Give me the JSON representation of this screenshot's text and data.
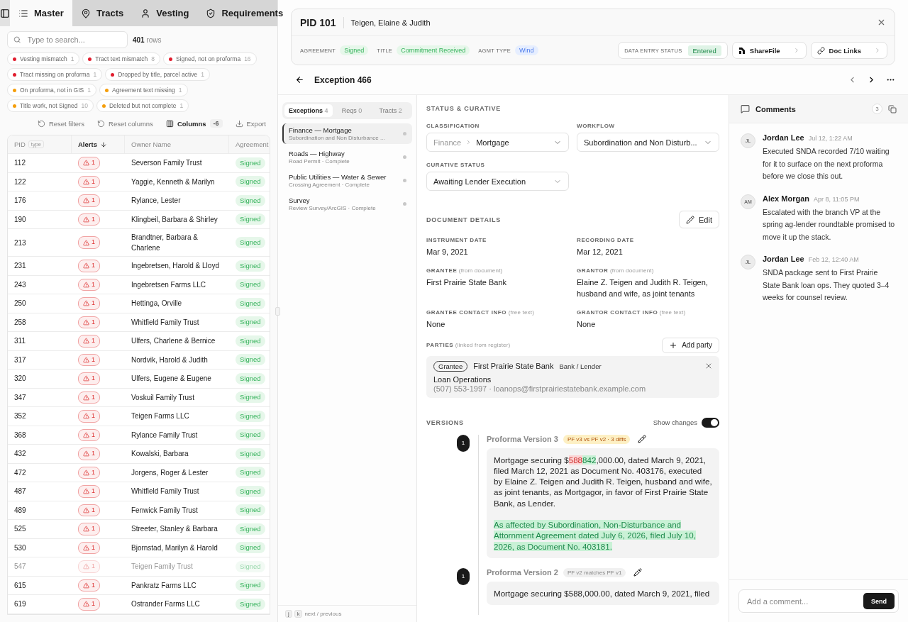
{
  "nav_tabs": [
    {
      "label": "Master",
      "kind": "list",
      "selected": true
    },
    {
      "label": "Tracts",
      "kind": "pin",
      "selected": false
    },
    {
      "label": "Vesting",
      "kind": "user",
      "selected": false
    },
    {
      "label": "Requirements",
      "kind": "shield",
      "selected": false
    }
  ],
  "search": {
    "placeholder": "Type to search...",
    "count": "401",
    "count_label": "rows"
  },
  "filters": [
    {
      "label": "Vesting mismatch",
      "count": "1",
      "color": "#e11d2e"
    },
    {
      "label": "Tract text mismatch",
      "count": "8",
      "color": "#e11d2e"
    },
    {
      "label": "Signed, not on proforma",
      "count": "16",
      "color": "#e11d2e"
    },
    {
      "label": "Tract missing on proforma",
      "count": "1",
      "color": "#e11d2e"
    },
    {
      "label": "Dropped by title, parcel active",
      "count": "1",
      "color": "#e11d2e"
    },
    {
      "label": "On proforma, not in GIS",
      "count": "1",
      "color": "#f59e0b"
    },
    {
      "label": "Agreement text missing",
      "count": "1",
      "color": "#f59e0b"
    },
    {
      "label": "Title work, not Signed",
      "count": "10",
      "color": "#f59e0b"
    },
    {
      "label": "Deleted but not complete",
      "count": "1",
      "color": "#f59e0b"
    }
  ],
  "table_actions": {
    "reset_filters": "Reset filters",
    "reset_columns": "Reset columns",
    "columns": "Columns",
    "columns_count": "-6",
    "export": "Export"
  },
  "table": {
    "columns": [
      {
        "label": "PID",
        "tag": "type",
        "sorted": false
      },
      {
        "label": "Alerts",
        "sorted": true
      },
      {
        "label": "Owner Name",
        "sorted": false
      },
      {
        "label": "Agreement",
        "sorted": false
      }
    ],
    "rows": [
      {
        "pid": "112",
        "alerts": "1",
        "owner": "Severson Family Trust",
        "agreement": "Signed",
        "dimmed": false
      },
      {
        "pid": "122",
        "alerts": "1",
        "owner": "Yaggie, Kenneth & Marilyn",
        "agreement": "Signed",
        "dimmed": false
      },
      {
        "pid": "176",
        "alerts": "1",
        "owner": "Rylance, Lester",
        "agreement": "Signed",
        "dimmed": false
      },
      {
        "pid": "190",
        "alerts": "1",
        "owner": "Klingbeil, Barbara & Shirley",
        "agreement": "Signed",
        "dimmed": false
      },
      {
        "pid": "213",
        "alerts": "1",
        "owner": "Brandtner, Barbara & Charlene",
        "agreement": "Signed",
        "dimmed": false
      },
      {
        "pid": "231",
        "alerts": "1",
        "owner": "Ingebretsen, Harold & Lloyd",
        "agreement": "Signed",
        "dimmed": false
      },
      {
        "pid": "243",
        "alerts": "1",
        "owner": "Ingebretsen Farms LLC",
        "agreement": "Signed",
        "dimmed": false
      },
      {
        "pid": "250",
        "alerts": "1",
        "owner": "Hettinga, Orville",
        "agreement": "Signed",
        "dimmed": false
      },
      {
        "pid": "258",
        "alerts": "1",
        "owner": "Whitfield Family Trust",
        "agreement": "Signed",
        "dimmed": false
      },
      {
        "pid": "311",
        "alerts": "1",
        "owner": "Ulfers, Charlene & Bernice",
        "agreement": "Signed",
        "dimmed": false
      },
      {
        "pid": "317",
        "alerts": "1",
        "owner": "Nordvik, Harold & Judith",
        "agreement": "Signed",
        "dimmed": false
      },
      {
        "pid": "320",
        "alerts": "1",
        "owner": "Ulfers, Eugene & Eugene",
        "agreement": "Signed",
        "dimmed": false
      },
      {
        "pid": "347",
        "alerts": "1",
        "owner": "Voskuil Family Trust",
        "agreement": "Signed",
        "dimmed": false
      },
      {
        "pid": "352",
        "alerts": "1",
        "owner": "Teigen Farms LLC",
        "agreement": "Signed",
        "dimmed": false
      },
      {
        "pid": "368",
        "alerts": "1",
        "owner": "Rylance Family Trust",
        "agreement": "Signed",
        "dimmed": false
      },
      {
        "pid": "432",
        "alerts": "1",
        "owner": "Kowalski, Barbara",
        "agreement": "Signed",
        "dimmed": false
      },
      {
        "pid": "472",
        "alerts": "1",
        "owner": "Jorgens, Roger & Lester",
        "agreement": "Signed",
        "dimmed": false
      },
      {
        "pid": "487",
        "alerts": "1",
        "owner": "Whitfield Family Trust",
        "agreement": "Signed",
        "dimmed": false
      },
      {
        "pid": "489",
        "alerts": "1",
        "owner": "Fenwick Family Trust",
        "agreement": "Signed",
        "dimmed": false
      },
      {
        "pid": "525",
        "alerts": "1",
        "owner": "Streeter, Stanley & Barbara",
        "agreement": "Signed",
        "dimmed": false
      },
      {
        "pid": "530",
        "alerts": "1",
        "owner": "Bjornstad, Marilyn & Harold",
        "agreement": "Signed",
        "dimmed": false
      },
      {
        "pid": "547",
        "alerts": "1",
        "owner": "Teigen Family Trust",
        "agreement": "Signed",
        "dimmed": true
      },
      {
        "pid": "615",
        "alerts": "1",
        "owner": "Pankratz Farms LLC",
        "agreement": "Signed",
        "dimmed": false
      },
      {
        "pid": "619",
        "alerts": "1",
        "owner": "Ostrander Farms LLC",
        "agreement": "Signed",
        "dimmed": false
      }
    ]
  },
  "record": {
    "pid": "PID 101",
    "owner": "Teigen, Elaine & Judith",
    "meta": [
      {
        "label": "AGREEMENT",
        "value": "Signed",
        "kind": "green"
      },
      {
        "label": "TITLE",
        "value": "Commitment Received",
        "kind": "green"
      },
      {
        "label": "AGMT TYPE",
        "value": "Wind",
        "kind": "blue"
      }
    ],
    "data_entry": {
      "label": "DATA ENTRY STATUS",
      "value": "Entered"
    },
    "links": [
      {
        "label": "ShareFile",
        "kind": "sharefile"
      },
      {
        "label": "Doc Links",
        "kind": "link"
      }
    ]
  },
  "exception": {
    "title": "Exception 466"
  },
  "exception_tabs": [
    {
      "label": "Exceptions",
      "count": "4",
      "selected": true
    },
    {
      "label": "Reqs",
      "count": "0",
      "selected": false
    },
    {
      "label": "Tracts",
      "count": "2",
      "selected": false
    }
  ],
  "exceptions": [
    {
      "title": "Finance — Mortgage",
      "subtitle": "Subordination and Non Disturbance ...",
      "selected": true
    },
    {
      "title": "Roads — Highway",
      "subtitle": "Road Permit · Complete",
      "selected": false
    },
    {
      "title": "Public Utilities — Water & Sewer",
      "subtitle": "Crossing Agreement · Complete",
      "selected": false
    },
    {
      "title": "Survey",
      "subtitle": "Review Survey/ArcGIS · Complete",
      "selected": false
    }
  ],
  "key_hint": {
    "keys": [
      "j",
      "k"
    ],
    "label": "next / previous"
  },
  "status": {
    "heading": "STATUS & CURATIVE",
    "classification_label": "CLASSIFICATION",
    "classification_parent": "Finance",
    "classification_value": "Mortgage",
    "workflow_label": "WORKFLOW",
    "workflow_value": "Subordination and Non Disturb...",
    "curative_label": "CURATIVE STATUS",
    "curative_value": "Awaiting Lender Execution"
  },
  "document": {
    "heading": "DOCUMENT DETAILS",
    "edit": "Edit",
    "fields": [
      {
        "label": "INSTRUMENT DATE",
        "value": "Mar 9, 2021"
      },
      {
        "label": "RECORDING DATE",
        "value": "Mar 12, 2021"
      },
      {
        "label": "GRANTEE",
        "note": "(from document)",
        "value": "First Prairie State Bank"
      },
      {
        "label": "GRANTOR",
        "note": "(from document)",
        "value": "Elaine Z. Teigen and Judith R. Teigen, husband and wife, as joint tenants"
      },
      {
        "label": "GRANTEE CONTACT INFO",
        "note": "(free text)",
        "value": "None"
      },
      {
        "label": "GRANTOR CONTACT INFO",
        "note": "(free text)",
        "value": "None"
      }
    ],
    "parties_label": "PARTIES",
    "parties_note": "(linked from register)",
    "add_party": "Add party",
    "parties": [
      {
        "role": "Grantee",
        "name": "First Prairie State Bank",
        "type": "Bank / Lender",
        "contact": "Loan Operations",
        "details": "(507) 553-1997 · loanops@firstprairiestatebank.example.com"
      }
    ]
  },
  "versions": {
    "heading": "VERSIONS",
    "show_changes_label": "Show changes",
    "show_changes": true,
    "items": [
      {
        "marker": "1",
        "title": "Proforma Version 3",
        "badge": {
          "text": "PF v3 vs PF v2 · 3 diffs",
          "kind": "diff"
        },
        "paragraphs": [
          [
            {
              "text": "Mortgage securing $",
              "kind": "plain"
            },
            {
              "text": "588",
              "kind": "removed"
            },
            {
              "text": "842",
              "kind": "added"
            },
            {
              "text": ",000.00, dated March 9, 2021, filed March 12, 2021 as Document No. 403176, executed by Elaine Z. Teigen and Judith R. Teigen, husband and wife, as joint tenants, as Mortgagor, in favor of First Prairie State Bank, as Lender.",
              "kind": "plain"
            }
          ],
          [
            {
              "text": "As affected by Subordination, Non-Disturbance and Attornment Agreement dated July 6, 2026, filed July 10, 2026, as Document No. 403181.",
              "kind": "added"
            }
          ]
        ]
      },
      {
        "marker": "1",
        "title": "Proforma Version 2",
        "badge": {
          "text": "PF v2 matches PF v1",
          "kind": "match"
        },
        "paragraphs": [
          [
            {
              "text": "Mortgage securing $588,000.00, dated March 9, 2021, filed",
              "kind": "plain"
            }
          ]
        ]
      }
    ]
  },
  "comments": {
    "title": "Comments",
    "count": "3",
    "items": [
      {
        "initials": "JL",
        "author": "Jordan Lee",
        "time": "Jul 12, 1:22 AM",
        "text": "Executed SNDA recorded 7/10 waiting for it to surface on the next proforma before we close this out."
      },
      {
        "initials": "AM",
        "author": "Alex Morgan",
        "time": "Apr 8, 11:05 PM",
        "text": "Escalated with the branch VP at the spring ag-lender roundtable promised to move it up the stack."
      },
      {
        "initials": "JL",
        "author": "Jordan Lee",
        "time": "Feb 12, 12:40 AM",
        "text": "SNDA package sent to First Prairie State Bank loan ops. They quoted 3–4 weeks for counsel review."
      }
    ],
    "placeholder": "Add a comment...",
    "send": "Send"
  }
}
